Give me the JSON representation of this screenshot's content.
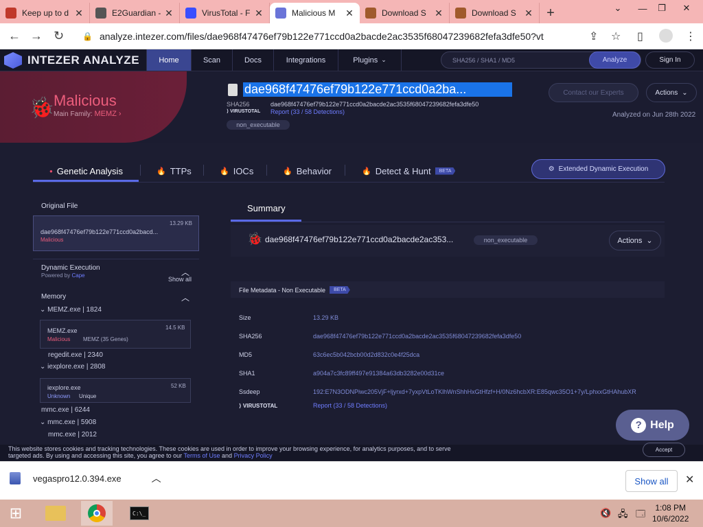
{
  "browser": {
    "tabs": [
      {
        "title": "Keep up to d",
        "icon": "bird-icon",
        "color": "#c0392b"
      },
      {
        "title": "E2Guardian -",
        "icon": "globe-icon",
        "color": "#555555"
      },
      {
        "title": "VirusTotal - F",
        "icon": "virustotal-icon",
        "color": "#394eff"
      },
      {
        "title": "Malicious M",
        "icon": "intezer-icon",
        "color": "#6a74d8",
        "active": true
      },
      {
        "title": "Download S",
        "icon": "download-site-icon",
        "color": "#a05a2c"
      },
      {
        "title": "Download S",
        "icon": "download-site-icon",
        "color": "#a05a2c"
      }
    ],
    "url": "analyze.intezer.com/files/dae968f47476ef79b122e771ccd0a2bacde2ac3535f68047239682fefa3dfe50?vt"
  },
  "site": {
    "brand": "INTEZER ANALYZE",
    "nav": [
      "Home",
      "Scan",
      "Docs",
      "Integrations",
      "Plugins"
    ],
    "search_placeholder": "SHA256 / SHA1 / MD5",
    "analyze_label": "Analyze",
    "signin_label": "Sign In"
  },
  "header": {
    "verdict": "Malicious",
    "family_label": "Main Family:",
    "family": "MEMZ",
    "file_title": "dae968f47476ef79b122e771ccd0a2ba...",
    "sha_label": "SHA256",
    "sha256": "dae968f47476ef79b122e771ccd0a2bacde2ac3535f68047239682fefa3dfe50",
    "vt_label": "VIRUSTOTAL",
    "vt_report": "Report (33 / 58 Detections)",
    "tag": "non_executable",
    "contact_label": "Contact our Experts",
    "actions_label": "Actions",
    "analyzed_on": "Analyzed on Jun 28th 2022"
  },
  "analysis_tabs": {
    "genetic": "Genetic Analysis",
    "ttps": "TTPs",
    "iocs": "IOCs",
    "behavior": "Behavior",
    "detect": "Detect & Hunt",
    "beta": "BETA",
    "extended": "Extended Dynamic Execution"
  },
  "sidebar": {
    "original_file": "Original File",
    "file_size": "13.29 KB",
    "file_name": "dae968f47476ef79b122e771ccd0a2bacd...",
    "file_verdict": "Malicious",
    "dynamic_title": "Dynamic Execution",
    "powered_by": "Powered by",
    "powered_name": "Cape",
    "show_all": "Show all",
    "memory": "Memory",
    "proc1": "MEMZ.exe | 1824",
    "card1_name": "MEMZ.exe",
    "card1_size": "14.5 KB",
    "card1_verdict": "Malicious",
    "card1_family": "MEMZ (35 Genes)",
    "proc2": "regedit.exe | 2340",
    "proc3": "iexplore.exe | 2808",
    "card2_name": "iexplore.exe",
    "card2_size": "52 KB",
    "card2_verdict": "Unknown",
    "card2_family": "Unique",
    "proc4": "mmc.exe | 6244",
    "proc5": "mmc.exe | 5908",
    "proc6": "mmc.exe | 2012"
  },
  "summary": {
    "tab": "Summary",
    "file": "dae968f47476ef79b122e771ccd0a2bacde2ac353...",
    "tag": "non_executable",
    "actions": "Actions",
    "meta_title": "File Metadata - Non Executable",
    "meta_beta": "BETA",
    "rows": [
      {
        "k": "Size",
        "v": "13.29 KB"
      },
      {
        "k": "SHA256",
        "v": "dae968f47476ef79b122e771ccd0a2bacde2ac3535f68047239682fefa3dfe50"
      },
      {
        "k": "MD5",
        "v": "63c6ec5b042bcb00d2d832c0e4f25dca"
      },
      {
        "k": "SHA1",
        "v": "a904a7c3fc89ff497e91384a63db3282e00d31ce"
      },
      {
        "k": "Ssdeep",
        "v": "192:E7N3ODNPiwc205VjF+ljyrxd+7yxpVtLoTKlhWnShhHxGtHfzf+H/0Nz6hcbXR:E85qwc35O1+7y/LphxxGtHAhubXR"
      }
    ],
    "vt_label": "VIRUSTOTAL",
    "vt_report": "Report (33 / 58 Detections)"
  },
  "help_label": "Help",
  "cookie": {
    "text1": "This website stores cookies and tracking technologies. These cookies are used in order to improve your browsing experience, for analytics purposes, and to serve",
    "text2": "targeted ads. By using and accessing this site, you agree to our",
    "terms": "Terms of Use",
    "and": "and",
    "privacy": "Privacy Policy",
    "accept": "Accept"
  },
  "download": {
    "file": "vegaspro12.0.394.exe",
    "show_all": "Show all"
  },
  "taskbar": {
    "time": "1:08 PM",
    "date": "10/6/2022"
  }
}
